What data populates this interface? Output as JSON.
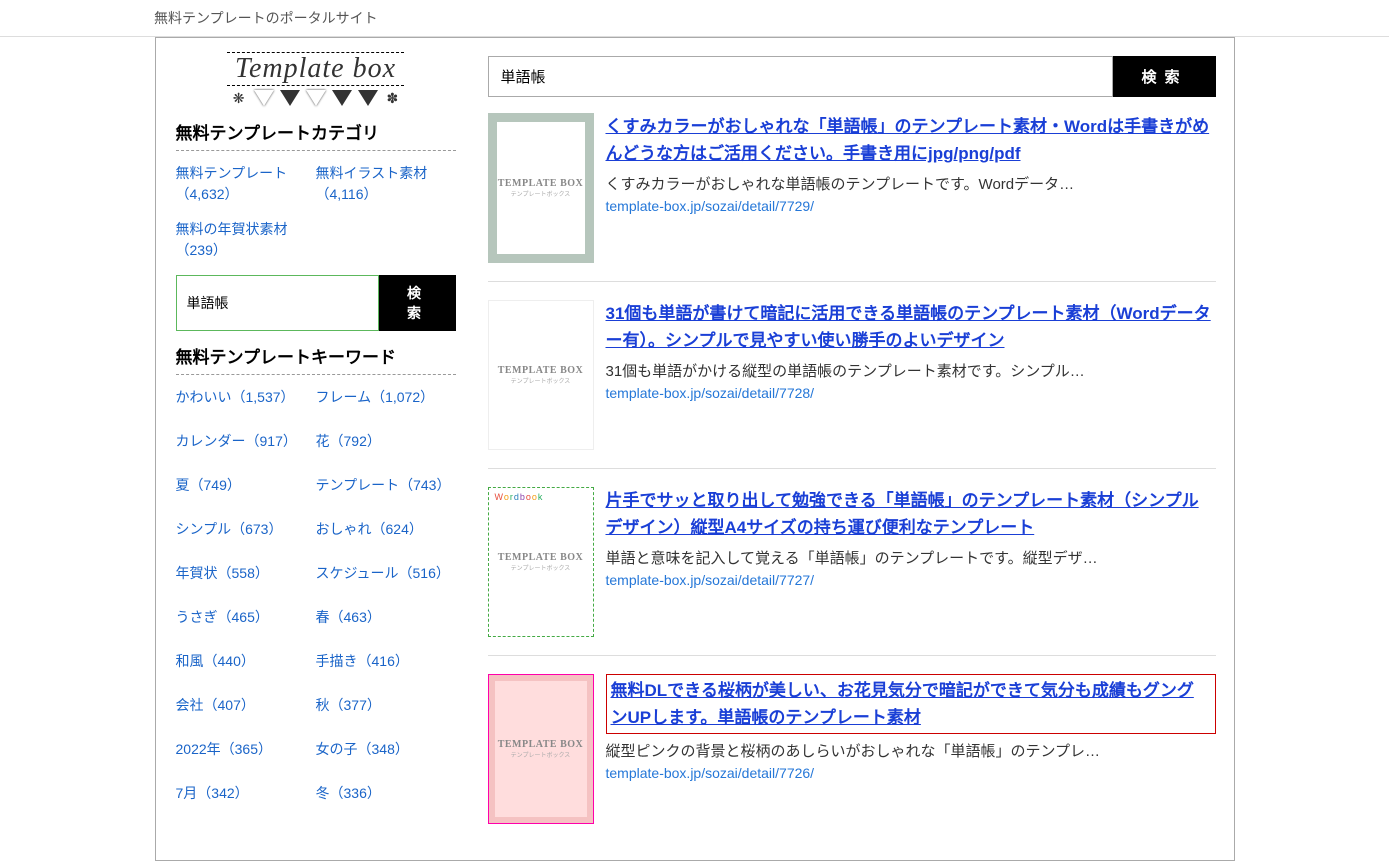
{
  "topBar": {
    "tagline": "無料テンプレートのポータルサイト"
  },
  "logo": {
    "text": "Template box"
  },
  "sidebar": {
    "categoryTitle": "無料テンプレートカテゴリ",
    "categories": [
      {
        "label": "無料テンプレート（4,632）"
      },
      {
        "label": "無料イラスト素材（4,116）"
      },
      {
        "label": "無料の年賀状素材（239）"
      }
    ],
    "searchValue": "単語帳",
    "searchButton": "検索",
    "keywordTitle": "無料テンプレートキーワード",
    "keywords": [
      {
        "label": "かわいい（1,537）"
      },
      {
        "label": "フレーム（1,072）"
      },
      {
        "label": "カレンダー（917）"
      },
      {
        "label": "花（792）"
      },
      {
        "label": "夏（749）"
      },
      {
        "label": "テンプレート（743）"
      },
      {
        "label": "シンプル（673）"
      },
      {
        "label": "おしゃれ（624）"
      },
      {
        "label": "年賀状（558）"
      },
      {
        "label": "スケジュール（516）"
      },
      {
        "label": "うさぎ（465）"
      },
      {
        "label": "春（463）"
      },
      {
        "label": "和風（440）"
      },
      {
        "label": "手描き（416）"
      },
      {
        "label": "会社（407）"
      },
      {
        "label": "秋（377）"
      },
      {
        "label": "2022年（365）"
      },
      {
        "label": "女の子（348）"
      },
      {
        "label": "7月（342）"
      },
      {
        "label": "冬（336）"
      }
    ]
  },
  "main": {
    "searchValue": "単語帳",
    "searchButton": "検索",
    "thumbLabel": "TEMPLATE BOX",
    "thumbSub": "テンプレートボックス",
    "results": [
      {
        "title": "くすみカラーがおしゃれな「単語帳」のテンプレート素材・Wordは手書きがめんどうな方はご活用ください。手書き用にjpg/png/pdf",
        "snippet": "くすみカラーがおしゃれな単語帳のテンプレートです。Wordデータ…",
        "url": "template-box.jp/sozai/detail/7729/"
      },
      {
        "title": "31個も単語が書けて暗記に活用できる単語帳のテンプレート素材（Wordデーター有）。シンプルで見やすい使い勝手のよいデザイン",
        "snippet": "31個も単語がかける縦型の単語帳のテンプレート素材です。シンプル…",
        "url": "template-box.jp/sozai/detail/7728/"
      },
      {
        "title": "片手でサッと取り出して勉強できる「単語帳」のテンプレート素材（シンプルデザイン）縦型A4サイズの持ち運び便利なテンプレート",
        "snippet": "単語と意味を記入して覚える「単語帳」のテンプレートです。縦型デザ…",
        "url": "template-box.jp/sozai/detail/7727/"
      },
      {
        "title": "無料DLできる桜柄が美しい、お花見気分で暗記ができて気分も成績もグングンUPします。単語帳のテンプレート素材",
        "snippet": "縦型ピンクの背景と桜柄のあしらいがおしゃれな「単語帳」のテンプレ…",
        "url": "template-box.jp/sozai/detail/7726/"
      }
    ]
  }
}
